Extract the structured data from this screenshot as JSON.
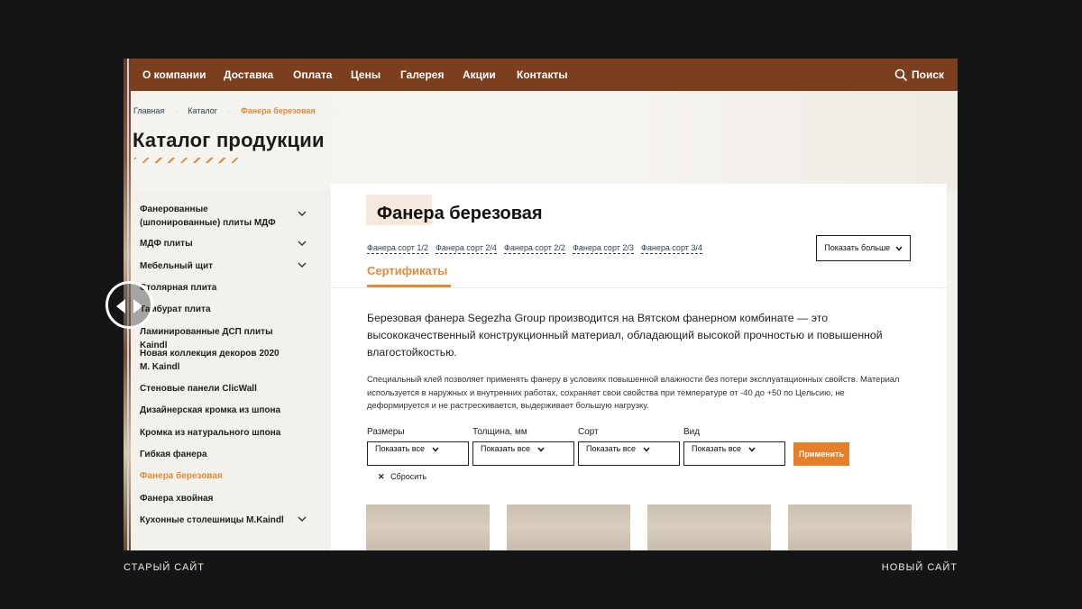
{
  "nav": {
    "items": [
      "О компании",
      "Доставка",
      "Оплата",
      "Цены",
      "Галерея",
      "Акции",
      "Контакты"
    ],
    "search_label": "Поиск"
  },
  "breadcrumb": {
    "home": "Главная",
    "catalog": "Каталог",
    "current": "Фанера березовая",
    "separator": "·"
  },
  "page_title": "Каталог продукции",
  "sidebar": {
    "items": [
      {
        "label": "Фанерованные (шпонированные) плиты МДФ",
        "expandable": true
      },
      {
        "label": "МДФ плиты",
        "expandable": true
      },
      {
        "label": "Мебельный щит",
        "expandable": true
      },
      {
        "label": "Столярная плита",
        "expandable": false
      },
      {
        "label": "Тамбурат плита",
        "expandable": false
      },
      {
        "label": "Ламинированные ДСП плиты Kaindl",
        "expandable": false
      },
      {
        "label": "Новая коллекция декоров 2020 M. Kaindl",
        "expandable": false
      },
      {
        "label": "Стеновые панели ClicWall",
        "expandable": false
      },
      {
        "label": "Дизайнерская кромка из шпона",
        "expandable": false
      },
      {
        "label": "Кромка из натурального шпона",
        "expandable": false
      },
      {
        "label": "Гибкая фанера",
        "expandable": false
      },
      {
        "label": "Фанера березовая",
        "expandable": false,
        "active": true
      },
      {
        "label": "Фанера хвойная",
        "expandable": false
      },
      {
        "label": "Кухонные столешницы M.Kaindl",
        "expandable": true
      }
    ]
  },
  "product": {
    "title": "Фанера березовая",
    "sub_links": [
      "Фанера сорт 1/2",
      "Фанера сорт 2/4",
      "Фанера сорт 2/2",
      "Фанера сорт 2/3",
      "Фанера сорт 3/4"
    ],
    "more_button": "Показать больше",
    "tab": "Сертификаты",
    "lead": "Березовая фанера Segezha Group производится на Вятском фанерном комбинате — это высококачественный конструкционный материал, обладающий высокой прочностью и повышенной влагостойкостью.",
    "description": "Специальный клей позволяет применять фанеру в условиях повышенной влажности без потери эксплуатационных свойств. Материал используется в наружных и внутренних работах, сохраняет свои свойства при температуре от -40 до +50 по Цельсию, не деформируется и не растрескивается, выдерживает большую нагрузку."
  },
  "filters": {
    "fields": [
      {
        "label": "Размеры",
        "value": "Показать все"
      },
      {
        "label": "Толщина, мм",
        "value": "Показать все"
      },
      {
        "label": "Сорт",
        "value": "Показать все"
      },
      {
        "label": "Вид",
        "value": "Показать все"
      }
    ],
    "apply": "Применить",
    "reset": "Сбросить",
    "reset_icon": "✕"
  },
  "captions": {
    "left": "СТАРЫЙ САЙТ",
    "right": "НОВЫЙ САЙТ"
  },
  "colors": {
    "nav_bg": "#7b3f1d",
    "accent": "#e08a3c",
    "button_orange": "#e57f2c",
    "page_bg": "#151515"
  }
}
